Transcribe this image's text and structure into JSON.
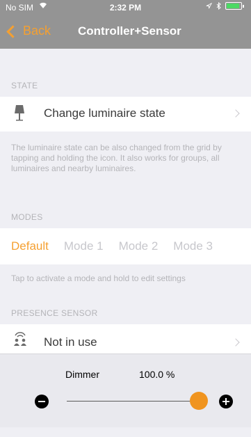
{
  "status_bar": {
    "carrier": "No SIM",
    "wifi_icon": "wifi-icon",
    "time": "2:32 PM"
  },
  "nav": {
    "back_label": "Back",
    "title": "Controller+Sensor"
  },
  "state_section": {
    "header": "STATE",
    "cell_label": "Change luminaire state",
    "footer": "The luminaire state can be also changed from the grid by tapping and holding the icon. It also works for groups, all luminaires and nearby luminaires."
  },
  "modes_section": {
    "header": "MODES",
    "modes": [
      {
        "label": "Default",
        "active": true
      },
      {
        "label": "Mode 1",
        "active": false
      },
      {
        "label": "Mode 2",
        "active": false
      },
      {
        "label": "Mode 3",
        "active": false
      }
    ],
    "footer": "Tap to activate a mode and hold to edit settings"
  },
  "presence_section": {
    "header": "PRESENCE SENSOR",
    "cell_label": "Not in use"
  },
  "dimmer": {
    "label": "Dimmer",
    "value_text": "100.0 %",
    "level": 1.0
  },
  "colors": {
    "accent": "#f5a031",
    "navbar": "#949494",
    "thumb": "#f0941f"
  }
}
